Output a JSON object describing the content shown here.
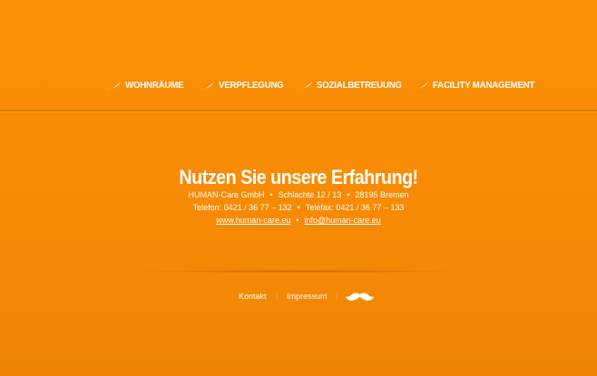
{
  "nav": {
    "items": [
      {
        "label": "WOHNRÄUME",
        "icon": "leaf-icon"
      },
      {
        "label": "VERPFLEGUNG",
        "icon": "leaf-icon"
      },
      {
        "label": "SOZIALBETREUUNG",
        "icon": "leaf-icon"
      },
      {
        "label": "FACILITY MANAGEMENT",
        "icon": "leaf-icon"
      }
    ]
  },
  "contact": {
    "headline": "Nutzen Sie unsere Erfahrung!",
    "company": "HUMAN-Care GmbH",
    "street": "Schlachte 12 / 13",
    "city": "28195 Bremen",
    "phone": "Telefon: 0421 / 36 77 – 132",
    "fax": "Telefax: 0421 / 36 77 – 133",
    "website": "www.human-care.eu",
    "email": "info@human-care.eu",
    "separator": "•"
  },
  "footer": {
    "kontakt": "Kontakt",
    "impressum": "Impressum",
    "pipe": "|",
    "icon": "mustache-icon"
  },
  "colors": {
    "background": "#f88c05",
    "text": "#ffffff",
    "divider": "#d9760a"
  }
}
